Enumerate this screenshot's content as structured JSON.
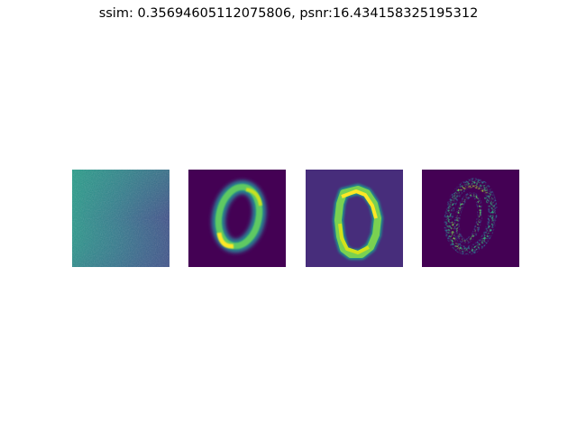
{
  "figure": {
    "title": "ssim: 0.35694605112075806, psnr:16.434158325195312"
  },
  "colormap": "viridis",
  "colors": {
    "viridis_dark": "#440154",
    "viridis_indigo": "#472d7b",
    "viridis_blue": "#3b528b",
    "viridis_teal": "#21918c",
    "viridis_green": "#5ec962",
    "viridis_yellow": "#fde725"
  },
  "panels": [
    {
      "id": "input",
      "axis": "off"
    },
    {
      "id": "target",
      "axis": "off"
    },
    {
      "id": "reconstruction",
      "axis": "off"
    },
    {
      "id": "difference",
      "axis": "off"
    }
  ]
}
